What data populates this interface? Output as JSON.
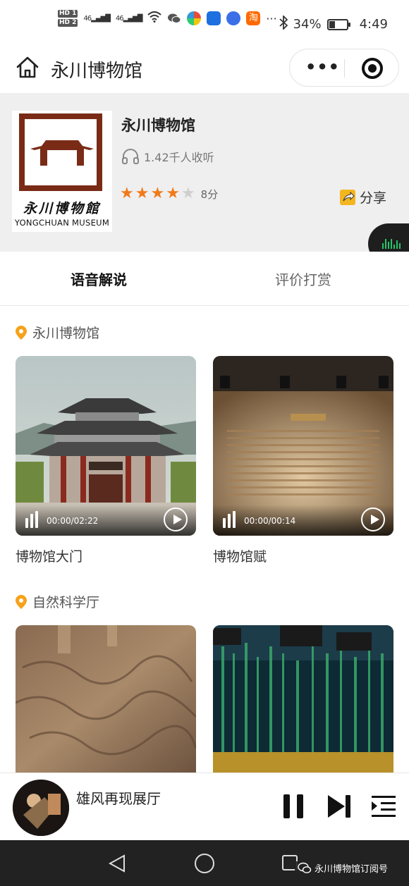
{
  "status_bar": {
    "hd1": "HD 1",
    "hd2": "HD 2",
    "signal1": "46",
    "signal2": "46",
    "more": "···",
    "battery_percent": "34%",
    "battery_level": 0.34,
    "time": "4:49",
    "app_icons": [
      "wechat-icon",
      "pinwheel-icon",
      "shield-icon",
      "music-icon",
      "taobao-icon"
    ],
    "taobao_glyph": "淘"
  },
  "navbar": {
    "title": "永川博物馆",
    "more_glyph": "•••"
  },
  "header": {
    "logo_calligraphy": "永川博物館",
    "logo_english": "YONGCHUAN MUSEUM",
    "name": "永川博物馆",
    "listeners": "1.42千人收听",
    "stars": 4,
    "star_total": 5,
    "score": "8分",
    "share_label": "分享"
  },
  "tabs": [
    {
      "label": "语音解说",
      "active": true
    },
    {
      "label": "评价打赏",
      "active": false
    }
  ],
  "sections": [
    {
      "title": "永川博物馆",
      "items": [
        {
          "label": "博物馆大门",
          "time": "00:00/02:22"
        },
        {
          "label": "博物馆赋",
          "time": "00:00/00:14"
        }
      ]
    },
    {
      "title": "自然科学厅",
      "items": [
        {
          "label": "",
          "time": ""
        },
        {
          "label": "",
          "time": ""
        }
      ]
    }
  ],
  "player": {
    "title": "雄风再现展厅"
  },
  "system_nav": {
    "wechat_account": "永川博物馆订阅号"
  },
  "colors": {
    "accent": "#f07a1b",
    "tab_underline": "#f7b325",
    "logo_brown": "#7a2b16",
    "pin": "#f5a21b"
  }
}
